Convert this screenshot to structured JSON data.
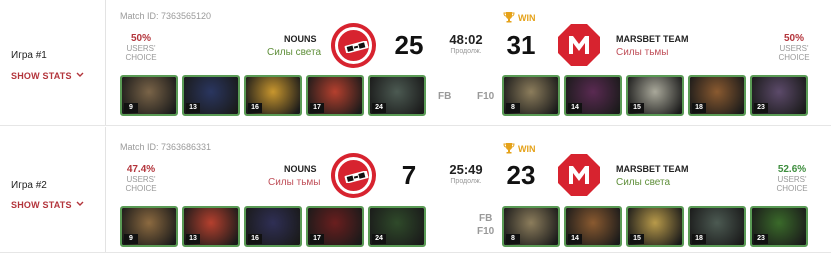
{
  "games": [
    {
      "label": "Игра #1",
      "show_stats": "SHOW STATS",
      "match_id": "Match ID: 7363565120",
      "left_choice": {
        "pct": "50%",
        "l1": "USERS'",
        "l2": "CHOICE",
        "color": "red"
      },
      "right_choice": {
        "pct": "50%",
        "l1": "USERS'",
        "l2": "CHOICE",
        "color": "red"
      },
      "team_left": {
        "name": "NOUNS",
        "side": "Силы света",
        "side_color": "green",
        "score": "25"
      },
      "team_right": {
        "name": "MARSBET TEAM",
        "side": "Силы тьмы",
        "side_color": "red",
        "score": "31"
      },
      "duration": "48:02",
      "duration_label": "Продолж.",
      "winner_label": "WIN",
      "left_flags": [
        "FB"
      ],
      "right_flags": [
        "F10"
      ],
      "left_heroes": [
        {
          "level": "9",
          "icon": "hero-bearded-warrior",
          "color": "#7a6448"
        },
        {
          "level": "13",
          "icon": "hero-shadow-knight",
          "color": "#2a3660"
        },
        {
          "level": "16",
          "icon": "hero-golden-mage",
          "color": "#c8962e"
        },
        {
          "level": "17",
          "icon": "hero-red-dryad",
          "color": "#b5402e"
        },
        {
          "level": "24",
          "icon": "hero-armored-beast",
          "color": "#4c5a52"
        }
      ],
      "right_heroes": [
        {
          "level": "8",
          "icon": "hero-pale-invoker",
          "color": "#8c7d5c"
        },
        {
          "level": "14",
          "icon": "hero-purple-witch",
          "color": "#5a2a52"
        },
        {
          "level": "15",
          "icon": "hero-white-beast",
          "color": "#a9a89a"
        },
        {
          "level": "18",
          "icon": "hero-goblin-tinker",
          "color": "#8a5a30"
        },
        {
          "level": "23",
          "icon": "hero-masked-assassin",
          "color": "#5c4a6a"
        }
      ]
    },
    {
      "label": "Игра #2",
      "show_stats": "SHOW STATS",
      "match_id": "Match ID: 7363686331",
      "left_choice": {
        "pct": "47.4%",
        "l1": "USERS'",
        "l2": "CHOICE",
        "color": "red"
      },
      "right_choice": {
        "pct": "52.6%",
        "l1": "USERS'",
        "l2": "CHOICE",
        "color": "green"
      },
      "team_left": {
        "name": "NOUNS",
        "side": "Силы тьмы",
        "side_color": "red",
        "score": "7"
      },
      "team_right": {
        "name": "MARSBET TEAM",
        "side": "Силы света",
        "side_color": "green",
        "score": "23"
      },
      "duration": "25:49",
      "duration_label": "Продолж.",
      "winner_label": "WIN",
      "left_flags": [],
      "right_flags": [
        "FB",
        "F10"
      ],
      "left_heroes": [
        {
          "level": "9",
          "icon": "hero-feral-beast",
          "color": "#8c6a40"
        },
        {
          "level": "13",
          "icon": "hero-red-dryad",
          "color": "#b5402e"
        },
        {
          "level": "16",
          "icon": "hero-shadow-knight",
          "color": "#2f2f55"
        },
        {
          "level": "17",
          "icon": "hero-hooded-rogue",
          "color": "#6a1e1e"
        },
        {
          "level": "24",
          "icon": "hero-venom-lurker",
          "color": "#2f4a2a"
        }
      ],
      "right_heroes": [
        {
          "level": "8",
          "icon": "hero-pale-invoker",
          "color": "#8c7d5c"
        },
        {
          "level": "14",
          "icon": "hero-goblin-tinker",
          "color": "#8a5a30"
        },
        {
          "level": "15",
          "icon": "hero-golden-knight",
          "color": "#b89a4a"
        },
        {
          "level": "18",
          "icon": "hero-armored-beast",
          "color": "#4c5a52"
        },
        {
          "level": "23",
          "icon": "hero-green-serpent",
          "color": "#3a6a2a"
        }
      ]
    }
  ],
  "colors": {
    "brand_red": "#d7232f",
    "win_gold": "#e5a21a",
    "hero_border": "#5a9b55"
  }
}
